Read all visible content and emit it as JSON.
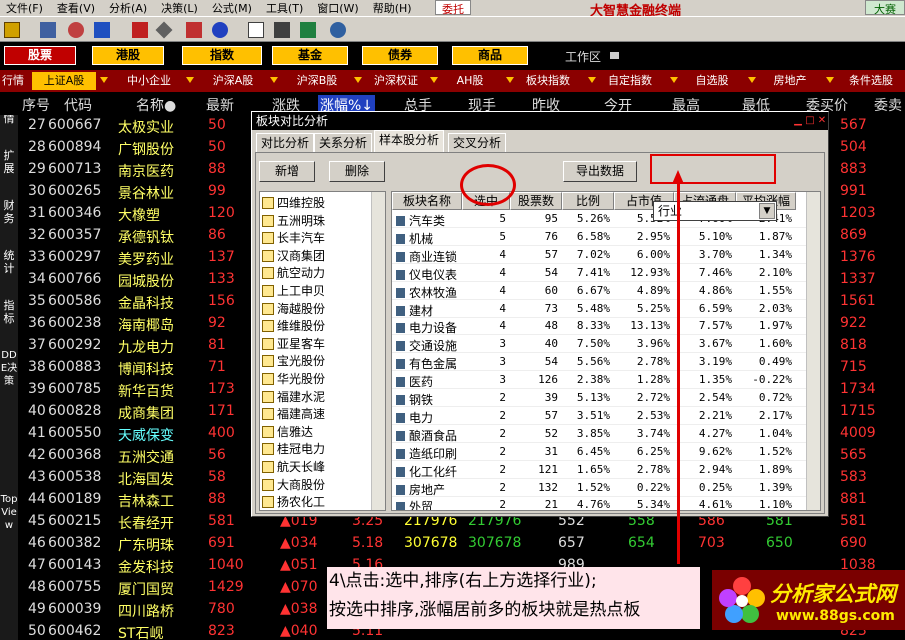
{
  "menu": [
    "文件(F)",
    "查看(V)",
    "分析(A)",
    "决策(L)",
    "公式(M)",
    "工具(T)",
    "窗口(W)",
    "帮助(H)"
  ],
  "brand": "大智慧金融终端",
  "btn_weituo": "委托",
  "btn_dasai": "大赛",
  "market_tabs": [
    "股票",
    "港股",
    "指数",
    "基金",
    "债券",
    "商品"
  ],
  "workarea_label": "工作区",
  "category_tabs": [
    "行情",
    "上证A股",
    "中小企业",
    "沪深A股",
    "沪深B股",
    "沪深权证",
    "AH股",
    "板块指数",
    "自定指数",
    "自选股",
    "房地产",
    "条件选股"
  ],
  "columns": [
    "序号",
    "代码",
    "名称●",
    "最新",
    "涨跌",
    "涨幅%↓",
    "总手",
    "现手",
    "昨收",
    "今开",
    "最高",
    "最低",
    "委买价",
    "委卖"
  ],
  "sidebar": [
    "行情",
    "扩展",
    "财务",
    "统计",
    "指标",
    "DDE决策",
    "TopView"
  ],
  "rows": [
    {
      "n": "27",
      "code": "600667",
      "name": "太极实业",
      "last": "50",
      "bid": "567"
    },
    {
      "n": "28",
      "code": "600894",
      "name": "广钢股份",
      "last": "50",
      "bid": "504"
    },
    {
      "n": "29",
      "code": "600713",
      "name": "南京医药",
      "last": "88",
      "bid": "883"
    },
    {
      "n": "30",
      "code": "600265",
      "name": "景谷林业",
      "last": "99",
      "bid": "991"
    },
    {
      "n": "31",
      "code": "600346",
      "name": "大橡塑",
      "last": "120",
      "bid": "1203"
    },
    {
      "n": "32",
      "code": "600357",
      "name": "承德钒钛",
      "last": "86",
      "bid": "869"
    },
    {
      "n": "33",
      "code": "600297",
      "name": "美罗药业",
      "last": "137",
      "bid": "1376"
    },
    {
      "n": "34",
      "code": "600766",
      "name": "园城股份",
      "last": "133",
      "bid": "1337"
    },
    {
      "n": "35",
      "code": "600586",
      "name": "金晶科技",
      "last": "156",
      "bid": "1561"
    },
    {
      "n": "36",
      "code": "600238",
      "name": "海南椰岛",
      "last": "92",
      "bid": "922"
    },
    {
      "n": "37",
      "code": "600292",
      "name": "九龙电力",
      "last": "81",
      "bid": "818"
    },
    {
      "n": "38",
      "code": "600883",
      "name": "博闻科技",
      "last": "71",
      "bid": "715"
    },
    {
      "n": "39",
      "code": "600785",
      "name": "新华百货",
      "last": "173",
      "bid": "1734"
    },
    {
      "n": "40",
      "code": "600828",
      "name": "成商集团",
      "last": "171",
      "bid": "1715"
    },
    {
      "n": "41",
      "code": "600550",
      "name": "天威保变",
      "last": "400",
      "bid": "4009"
    },
    {
      "n": "42",
      "code": "600368",
      "name": "五洲交通",
      "last": "56",
      "bid": "565"
    },
    {
      "n": "43",
      "code": "600538",
      "name": "北海国发",
      "last": "58",
      "bid": "583"
    },
    {
      "n": "44",
      "code": "600189",
      "name": "吉林森工",
      "last": "88",
      "bid": "881"
    },
    {
      "n": "45",
      "code": "600215",
      "name": "长春经开",
      "last": "581",
      "chg": "▲019",
      "pct": "3.25",
      "vol": "217976",
      "cur": "217976",
      "prev": "552",
      "open": "558",
      "high": "586",
      "low": "581",
      "bid": "581"
    },
    {
      "n": "46",
      "code": "600382",
      "name": "广东明珠",
      "last": "691",
      "chg": "▲034",
      "pct": "5.18",
      "vol": "307678",
      "cur": "307678",
      "prev": "657",
      "open": "654",
      "high": "703",
      "low": "650",
      "bid": "690"
    },
    {
      "n": "47",
      "code": "600143",
      "name": "金发科技",
      "last": "1040",
      "chg": "▲051",
      "pct": "5.16",
      "vol": "",
      "cur": "",
      "prev": "989",
      "open": "",
      "high": "",
      "low": "",
      "bid": "1038"
    },
    {
      "n": "48",
      "code": "600755",
      "name": "厦门国贸",
      "last": "1429",
      "chg": "▲070",
      "pct": "5.15",
      "vol": "",
      "cur": "",
      "prev": "",
      "open": "",
      "high": "",
      "low": "",
      "bid": "1429"
    },
    {
      "n": "49",
      "code": "600039",
      "name": "四川路桥",
      "last": "780",
      "chg": "▲038",
      "pct": "5.12",
      "vol": "",
      "cur": "",
      "prev": "",
      "open": "",
      "high": "",
      "low": "",
      "bid": "780"
    },
    {
      "n": "50",
      "code": "600462",
      "name": "ST石岘",
      "last": "823",
      "chg": "▲040",
      "pct": "5.11",
      "vol": "",
      "cur": "",
      "prev": "",
      "open": "",
      "high": "",
      "low": "",
      "bid": "823"
    }
  ],
  "dialog": {
    "title": "板块对比分析",
    "tabs": [
      "对比分析",
      "关系分析",
      "样本股分析",
      "交叉分析"
    ],
    "btn_add": "新增",
    "btn_delete": "删除",
    "btn_export": "导出数据",
    "combo_value": "行业",
    "left_list": [
      "四维控股",
      "五洲明珠",
      "长丰汽车",
      "汉商集团",
      "航空动力",
      "上工申贝",
      "海越股份",
      "维维股份",
      "亚星客车",
      "宝光股份",
      "华光股份",
      "福建水泥",
      "福建高速",
      "信雅达",
      "桂冠电力",
      "航天长峰",
      "大商股份",
      "扬农化工"
    ],
    "grid_headers": [
      "板块名称",
      "选中",
      "股票数",
      "比例",
      "占市值",
      "占流通盘",
      "平均涨幅"
    ],
    "grid_rows": [
      [
        "汽车类",
        "5",
        "95",
        "5.26%",
        "5.52%",
        "7.60%",
        "2.41%"
      ],
      [
        "机械",
        "5",
        "76",
        "6.58%",
        "2.95%",
        "5.10%",
        "1.87%"
      ],
      [
        "商业连锁",
        "4",
        "57",
        "7.02%",
        "6.00%",
        "3.70%",
        "1.34%"
      ],
      [
        "仪电仪表",
        "4",
        "54",
        "7.41%",
        "12.93%",
        "7.46%",
        "2.10%"
      ],
      [
        "农林牧渔",
        "4",
        "60",
        "6.67%",
        "4.89%",
        "4.86%",
        "1.55%"
      ],
      [
        "建材",
        "4",
        "73",
        "5.48%",
        "5.25%",
        "6.59%",
        "2.03%"
      ],
      [
        "电力设备",
        "4",
        "48",
        "8.33%",
        "13.13%",
        "7.57%",
        "1.97%"
      ],
      [
        "交通设施",
        "3",
        "40",
        "7.50%",
        "3.96%",
        "3.67%",
        "1.60%"
      ],
      [
        "有色金属",
        "3",
        "54",
        "5.56%",
        "2.78%",
        "3.19%",
        "0.49%"
      ],
      [
        "医药",
        "3",
        "126",
        "2.38%",
        "1.28%",
        "1.35%",
        "-0.22%"
      ],
      [
        "钢铁",
        "2",
        "39",
        "5.13%",
        "2.72%",
        "2.54%",
        "0.72%"
      ],
      [
        "电力",
        "2",
        "57",
        "3.51%",
        "2.53%",
        "2.21%",
        "2.17%"
      ],
      [
        "酿酒食品",
        "2",
        "52",
        "3.85%",
        "3.74%",
        "4.27%",
        "1.04%"
      ],
      [
        "造纸印刷",
        "2",
        "31",
        "6.45%",
        "6.25%",
        "9.62%",
        "1.52%"
      ],
      [
        "化工化纤",
        "2",
        "121",
        "1.65%",
        "2.78%",
        "2.94%",
        "1.89%"
      ],
      [
        "房地产",
        "2",
        "132",
        "1.52%",
        "0.22%",
        "0.25%",
        "1.39%"
      ],
      [
        "外贸",
        "2",
        "21",
        "4.76%",
        "5.34%",
        "4.61%",
        "1.10%"
      ]
    ]
  },
  "annotation": {
    "line1": "4\\点击:选中,排序(右上方选择行业);",
    "line2": "按选中排序,涨幅居前多的板块就是热点板"
  },
  "logo": {
    "text": "分析家公式网",
    "url": "www.88gs.com"
  },
  "colors": {
    "annotation_red": "#e00000",
    "highlight_yellow": "#ffc000",
    "up": "#ff3333",
    "down": "#33cc33"
  }
}
